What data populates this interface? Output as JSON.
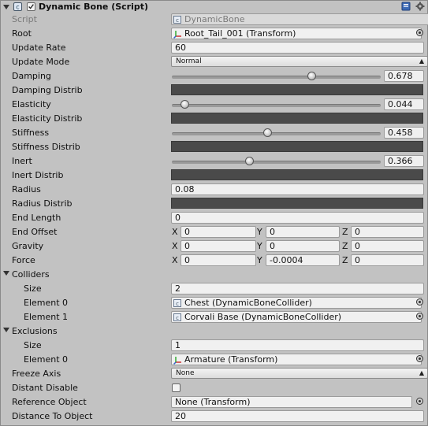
{
  "component": {
    "title": "Dynamic Bone (Script)",
    "enabled": true
  },
  "fields": {
    "script": {
      "label": "Script",
      "value": "DynamicBone"
    },
    "root": {
      "label": "Root",
      "value": "Root_Tail_001 (Transform)"
    },
    "update_rate": {
      "label": "Update Rate",
      "value": "60"
    },
    "update_mode": {
      "label": "Update Mode",
      "value": "Normal"
    },
    "damping": {
      "label": "Damping",
      "value": "0.678",
      "slider": 0.678
    },
    "damping_distrib": {
      "label": "Damping Distrib"
    },
    "elasticity": {
      "label": "Elasticity",
      "value": "0.044",
      "slider": 0.044
    },
    "elasticity_distrib": {
      "label": "Elasticity Distrib"
    },
    "stiffness": {
      "label": "Stiffness",
      "value": "0.458",
      "slider": 0.458
    },
    "stiffness_distrib": {
      "label": "Stiffness Distrib"
    },
    "inert": {
      "label": "Inert",
      "value": "0.366",
      "slider": 0.366
    },
    "inert_distrib": {
      "label": "Inert Distrib"
    },
    "radius": {
      "label": "Radius",
      "value": "0.08"
    },
    "radius_distrib": {
      "label": "Radius Distrib"
    },
    "end_length": {
      "label": "End Length",
      "value": "0"
    },
    "end_offset": {
      "label": "End Offset",
      "x": "0",
      "y": "0",
      "z": "0"
    },
    "gravity": {
      "label": "Gravity",
      "x": "0",
      "y": "0",
      "z": "0"
    },
    "force": {
      "label": "Force",
      "x": "0",
      "y": "-0.0004",
      "z": "0"
    },
    "colliders": {
      "label": "Colliders",
      "size_label": "Size",
      "size": "2",
      "element0_label": "Element 0",
      "element0": "Chest (DynamicBoneCollider)",
      "element1_label": "Element 1",
      "element1": "Corvali Base (DynamicBoneCollider)"
    },
    "exclusions": {
      "label": "Exclusions",
      "size_label": "Size",
      "size": "1",
      "element0_label": "Element 0",
      "element0": "Armature (Transform)"
    },
    "freeze_axis": {
      "label": "Freeze Axis",
      "value": "None"
    },
    "distant_disable": {
      "label": "Distant Disable",
      "checked": false
    },
    "reference_object": {
      "label": "Reference Object",
      "value": "None (Transform)"
    },
    "distance_to_object": {
      "label": "Distance To Object",
      "value": "20"
    }
  },
  "axis_letters": {
    "x": "X",
    "y": "Y",
    "z": "Z"
  },
  "colors": {
    "curve_bg": "#4a4a4a",
    "panel_bg": "#c2c2c2"
  }
}
